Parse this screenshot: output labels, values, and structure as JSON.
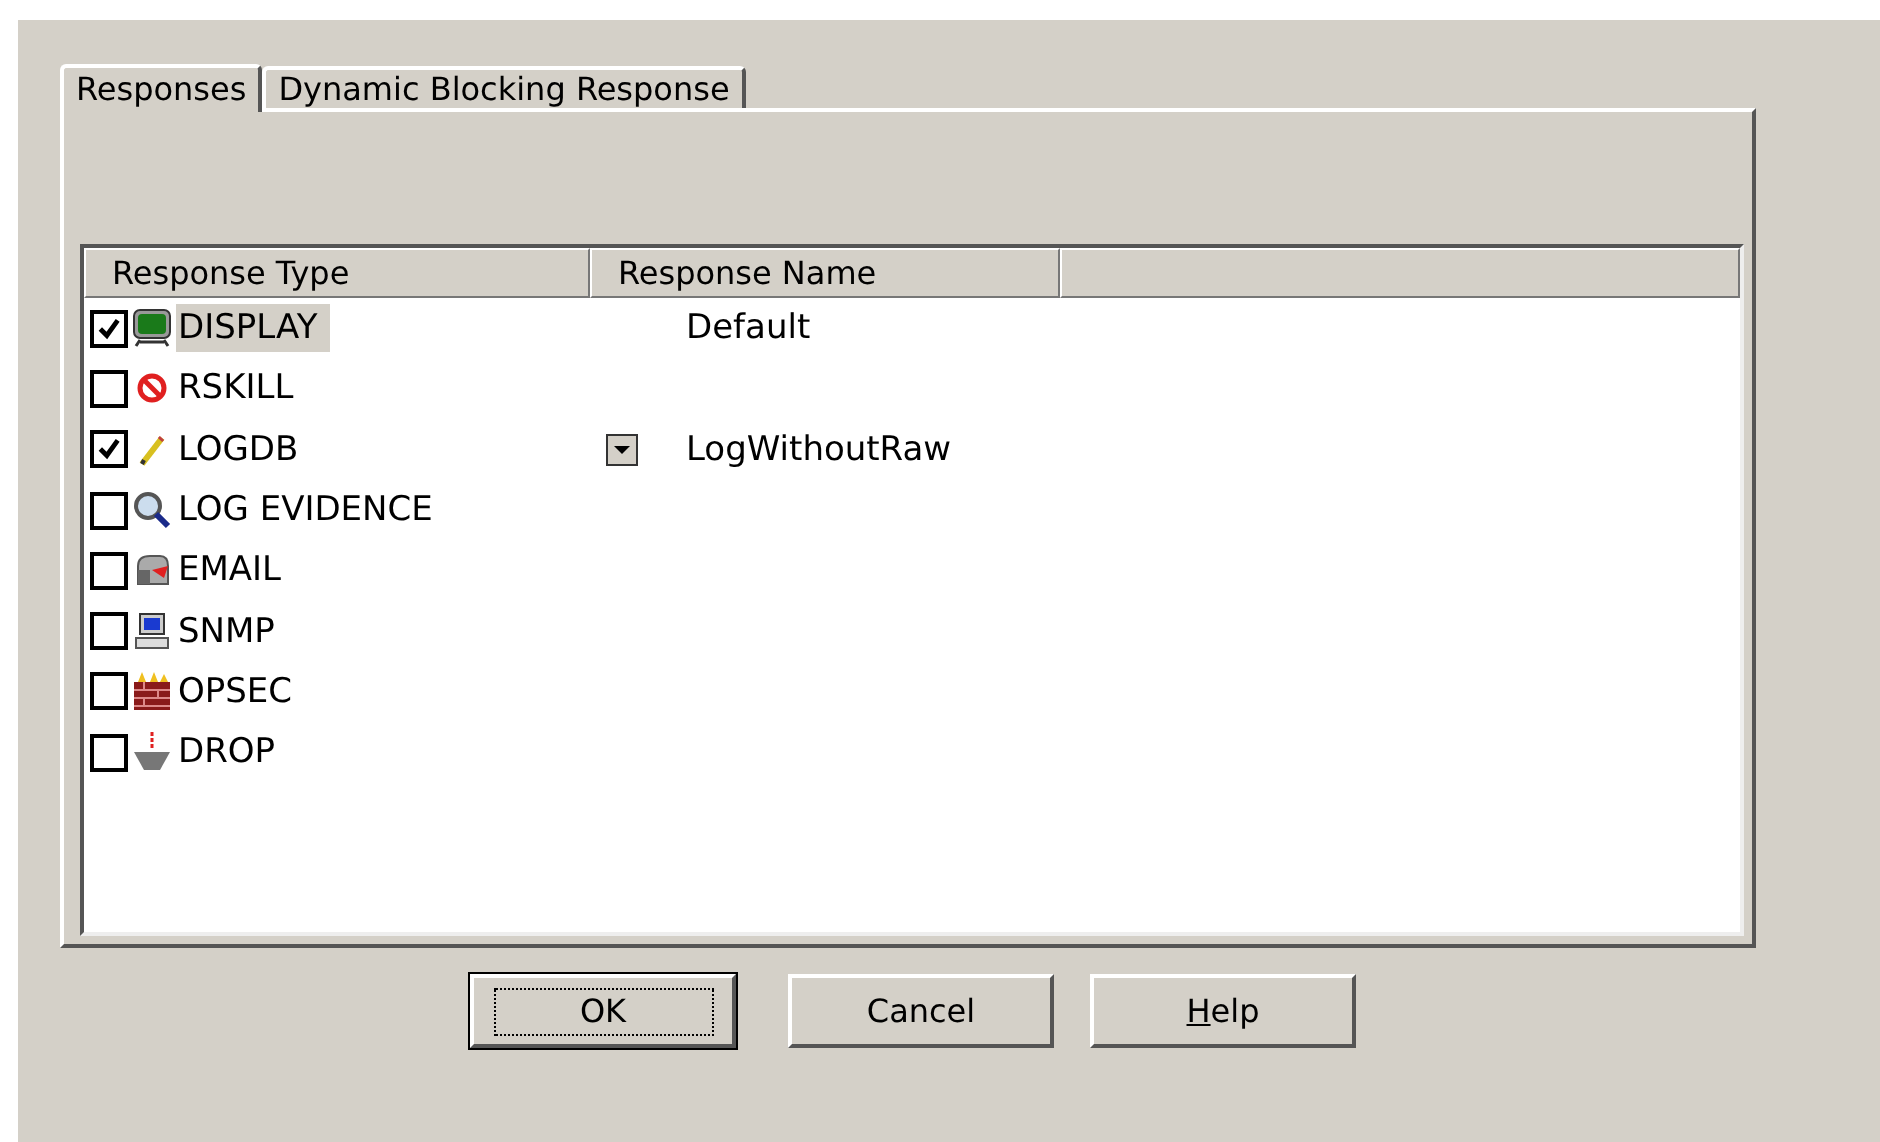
{
  "tabs": [
    {
      "label": "Responses",
      "selected": true
    },
    {
      "label": "Dynamic Blocking Response",
      "selected": false
    }
  ],
  "list": {
    "columns": [
      "Response Type",
      "Response Name"
    ],
    "rows": [
      {
        "type": "DISPLAY",
        "checked": true,
        "selected": true,
        "response_name": "Default",
        "dropdown": false
      },
      {
        "type": "RSKILL",
        "checked": false,
        "selected": false
      },
      {
        "type": "LOGDB",
        "checked": true,
        "selected": false,
        "response_name": "LogWithoutRaw",
        "dropdown": true
      },
      {
        "type": "LOG EVIDENCE",
        "checked": false,
        "selected": false
      },
      {
        "type": "EMAIL",
        "checked": false,
        "selected": false
      },
      {
        "type": "SNMP",
        "checked": false,
        "selected": false
      },
      {
        "type": "OPSEC",
        "checked": false,
        "selected": false
      },
      {
        "type": "DROP",
        "checked": false,
        "selected": false
      }
    ]
  },
  "buttons": [
    {
      "label": "OK",
      "default": true,
      "underline_first": false
    },
    {
      "label": "Cancel",
      "default": false,
      "underline_first": false
    },
    {
      "label": "Help",
      "default": false,
      "underline_first": true
    }
  ]
}
